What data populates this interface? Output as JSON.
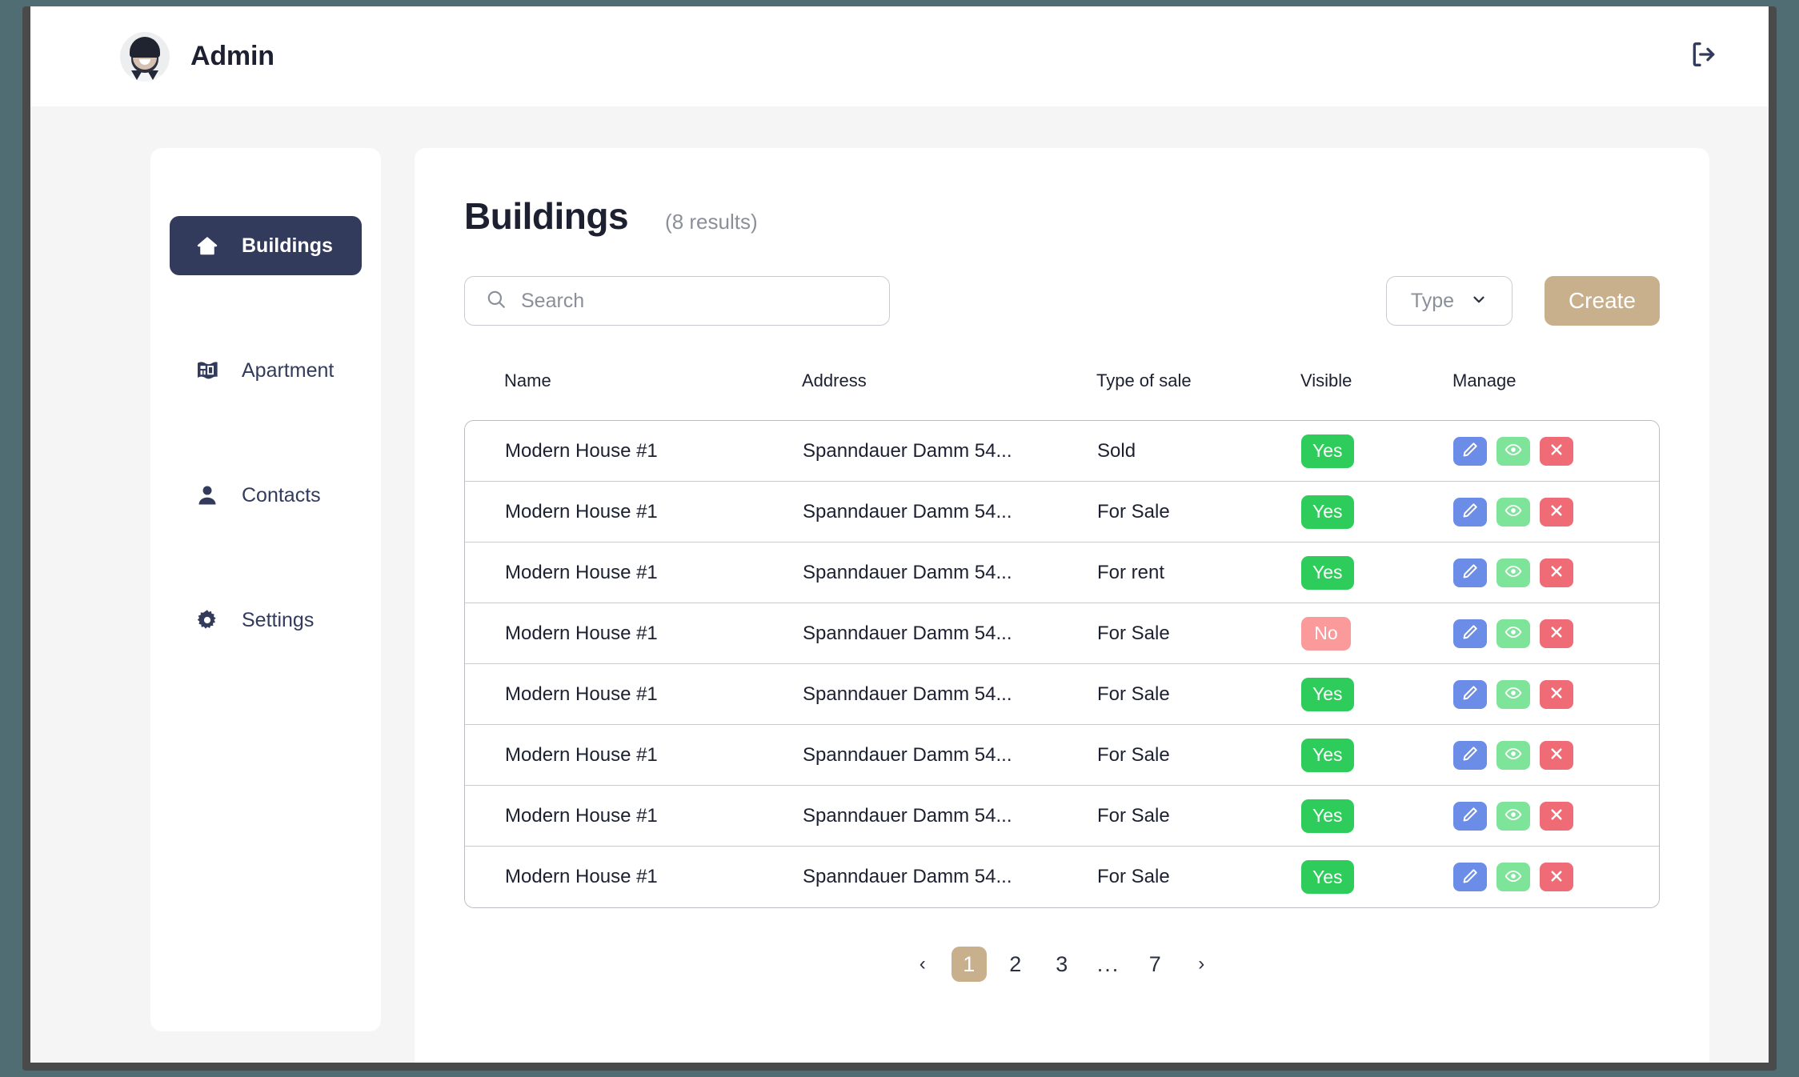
{
  "colors": {
    "accent": "#c9b08c",
    "sidebar_active": "#333b5c",
    "badge_yes": "#2ecc5b",
    "badge_no": "#fb9a9a",
    "action_edit": "#6b8de8",
    "action_view": "#7ee49a",
    "action_delete": "#ef6b75",
    "page_background": "#f5f5f5",
    "desktop_background": "#4f6d73"
  },
  "topbar": {
    "user_name": "Admin",
    "avatar_icon": "user-avatar-photo",
    "logout_icon": "logout-icon"
  },
  "sidebar": {
    "items": [
      {
        "label": "Buildings",
        "icon": "home-icon",
        "active": true
      },
      {
        "label": "Apartment",
        "icon": "blueprint-icon",
        "active": false
      },
      {
        "label": "Contacts",
        "icon": "person-icon",
        "active": false
      },
      {
        "label": "Settings",
        "icon": "gear-icon",
        "active": false
      }
    ]
  },
  "main": {
    "title": "Buildings",
    "results_count": "(8 results)",
    "search": {
      "value": "",
      "placeholder": "Search",
      "icon": "search-icon"
    },
    "type_filter": {
      "label": "Type",
      "icon": "chevron-down-icon"
    },
    "create_label": "Create",
    "table": {
      "headers": [
        "Name",
        "Address",
        "Type of sale",
        "Visible",
        "Manage"
      ],
      "rows": [
        {
          "name": "Modern House #1",
          "address": "Spanndauer Damm 54...",
          "type_of_sale": "Sold",
          "visible": "Yes"
        },
        {
          "name": "Modern House #1",
          "address": "Spanndauer Damm 54...",
          "type_of_sale": "For Sale",
          "visible": "Yes"
        },
        {
          "name": "Modern House #1",
          "address": "Spanndauer Damm 54...",
          "type_of_sale": "For rent",
          "visible": "Yes"
        },
        {
          "name": "Modern House #1",
          "address": "Spanndauer Damm 54...",
          "type_of_sale": "For Sale",
          "visible": "No"
        },
        {
          "name": "Modern House #1",
          "address": "Spanndauer Damm 54...",
          "type_of_sale": "For Sale",
          "visible": "Yes"
        },
        {
          "name": "Modern House #1",
          "address": "Spanndauer Damm 54...",
          "type_of_sale": "For Sale",
          "visible": "Yes"
        },
        {
          "name": "Modern House #1",
          "address": "Spanndauer Damm 54...",
          "type_of_sale": "For Sale",
          "visible": "Yes"
        },
        {
          "name": "Modern House #1",
          "address": "Spanndauer Damm 54...",
          "type_of_sale": "For Sale",
          "visible": "Yes"
        }
      ],
      "row_actions": [
        {
          "name": "edit",
          "icon": "pencil-icon"
        },
        {
          "name": "view",
          "icon": "eye-icon"
        },
        {
          "name": "delete",
          "icon": "close-x-icon"
        }
      ]
    },
    "pagination": {
      "prev_icon": "chevron-left-icon",
      "next_icon": "chevron-right-icon",
      "pages": [
        "1",
        "2",
        "3",
        "...",
        "7"
      ],
      "current": "1"
    }
  }
}
